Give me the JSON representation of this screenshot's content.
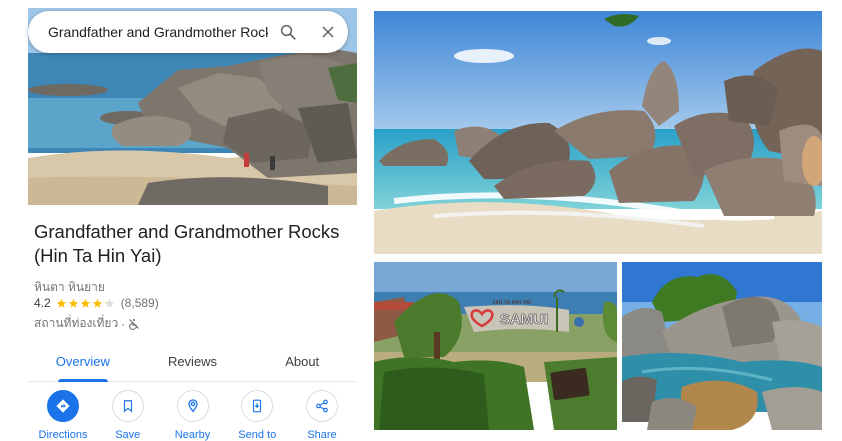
{
  "search": {
    "query": "Grandfather and Grandmother Rocks"
  },
  "place": {
    "title": "Grandfather and Grandmother Rocks (Hin Ta Hin Yai)",
    "local_name": "หินตา หินยาย",
    "rating": "4.2",
    "rating_value": 4.2,
    "review_count": "(8,589)",
    "category": "สถานที่ท่องเที่ยว",
    "separator": "·"
  },
  "tabs": [
    {
      "label": "Overview",
      "active": true
    },
    {
      "label": "Reviews",
      "active": false
    },
    {
      "label": "About",
      "active": false
    }
  ],
  "actions": [
    {
      "label": "Directions",
      "icon": "directions-icon"
    },
    {
      "label": "Save",
      "icon": "bookmark-icon"
    },
    {
      "label": "Nearby",
      "icon": "nearby-icon"
    },
    {
      "label": "Send to",
      "icon": "send-to-phone-icon"
    },
    {
      "label": "Share",
      "icon": "share-icon"
    }
  ],
  "photos": {
    "sign_text": "HIN TA HIN YAI",
    "sign_big": "SAMUI"
  },
  "colors": {
    "accent": "#1a73e8",
    "star": "#fbbc04",
    "muted": "#70757a"
  }
}
